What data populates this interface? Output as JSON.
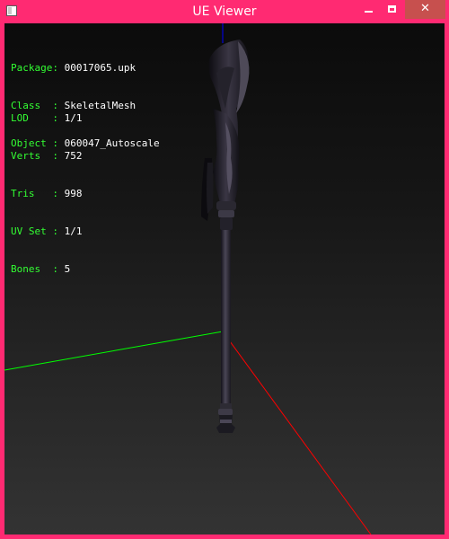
{
  "window": {
    "title": "UE Viewer",
    "close_glyph": "✕",
    "icon": "app-icon"
  },
  "colors": {
    "frame": "#ff2a72",
    "close_button": "#c7504e",
    "label_text": "#33ff33",
    "value_text": "#ffffff",
    "axis_x": "#ff0000",
    "axis_y": "#00ff00",
    "axis_z": "#0000ff"
  },
  "object_info": [
    {
      "label": "Package:",
      "value": "00017065.upk"
    },
    {
      "label": "Class  :",
      "value": "SkeletalMesh"
    },
    {
      "label": "Object :",
      "value": "060047_Autoscale"
    }
  ],
  "mesh_info": [
    {
      "label": "LOD    :",
      "value": "1/1"
    },
    {
      "label": "Verts  :",
      "value": "752"
    },
    {
      "label": "Tris   :",
      "value": "998"
    },
    {
      "label": "UV Set :",
      "value": "1/1"
    },
    {
      "label": "Bones  :",
      "value": "5"
    }
  ]
}
